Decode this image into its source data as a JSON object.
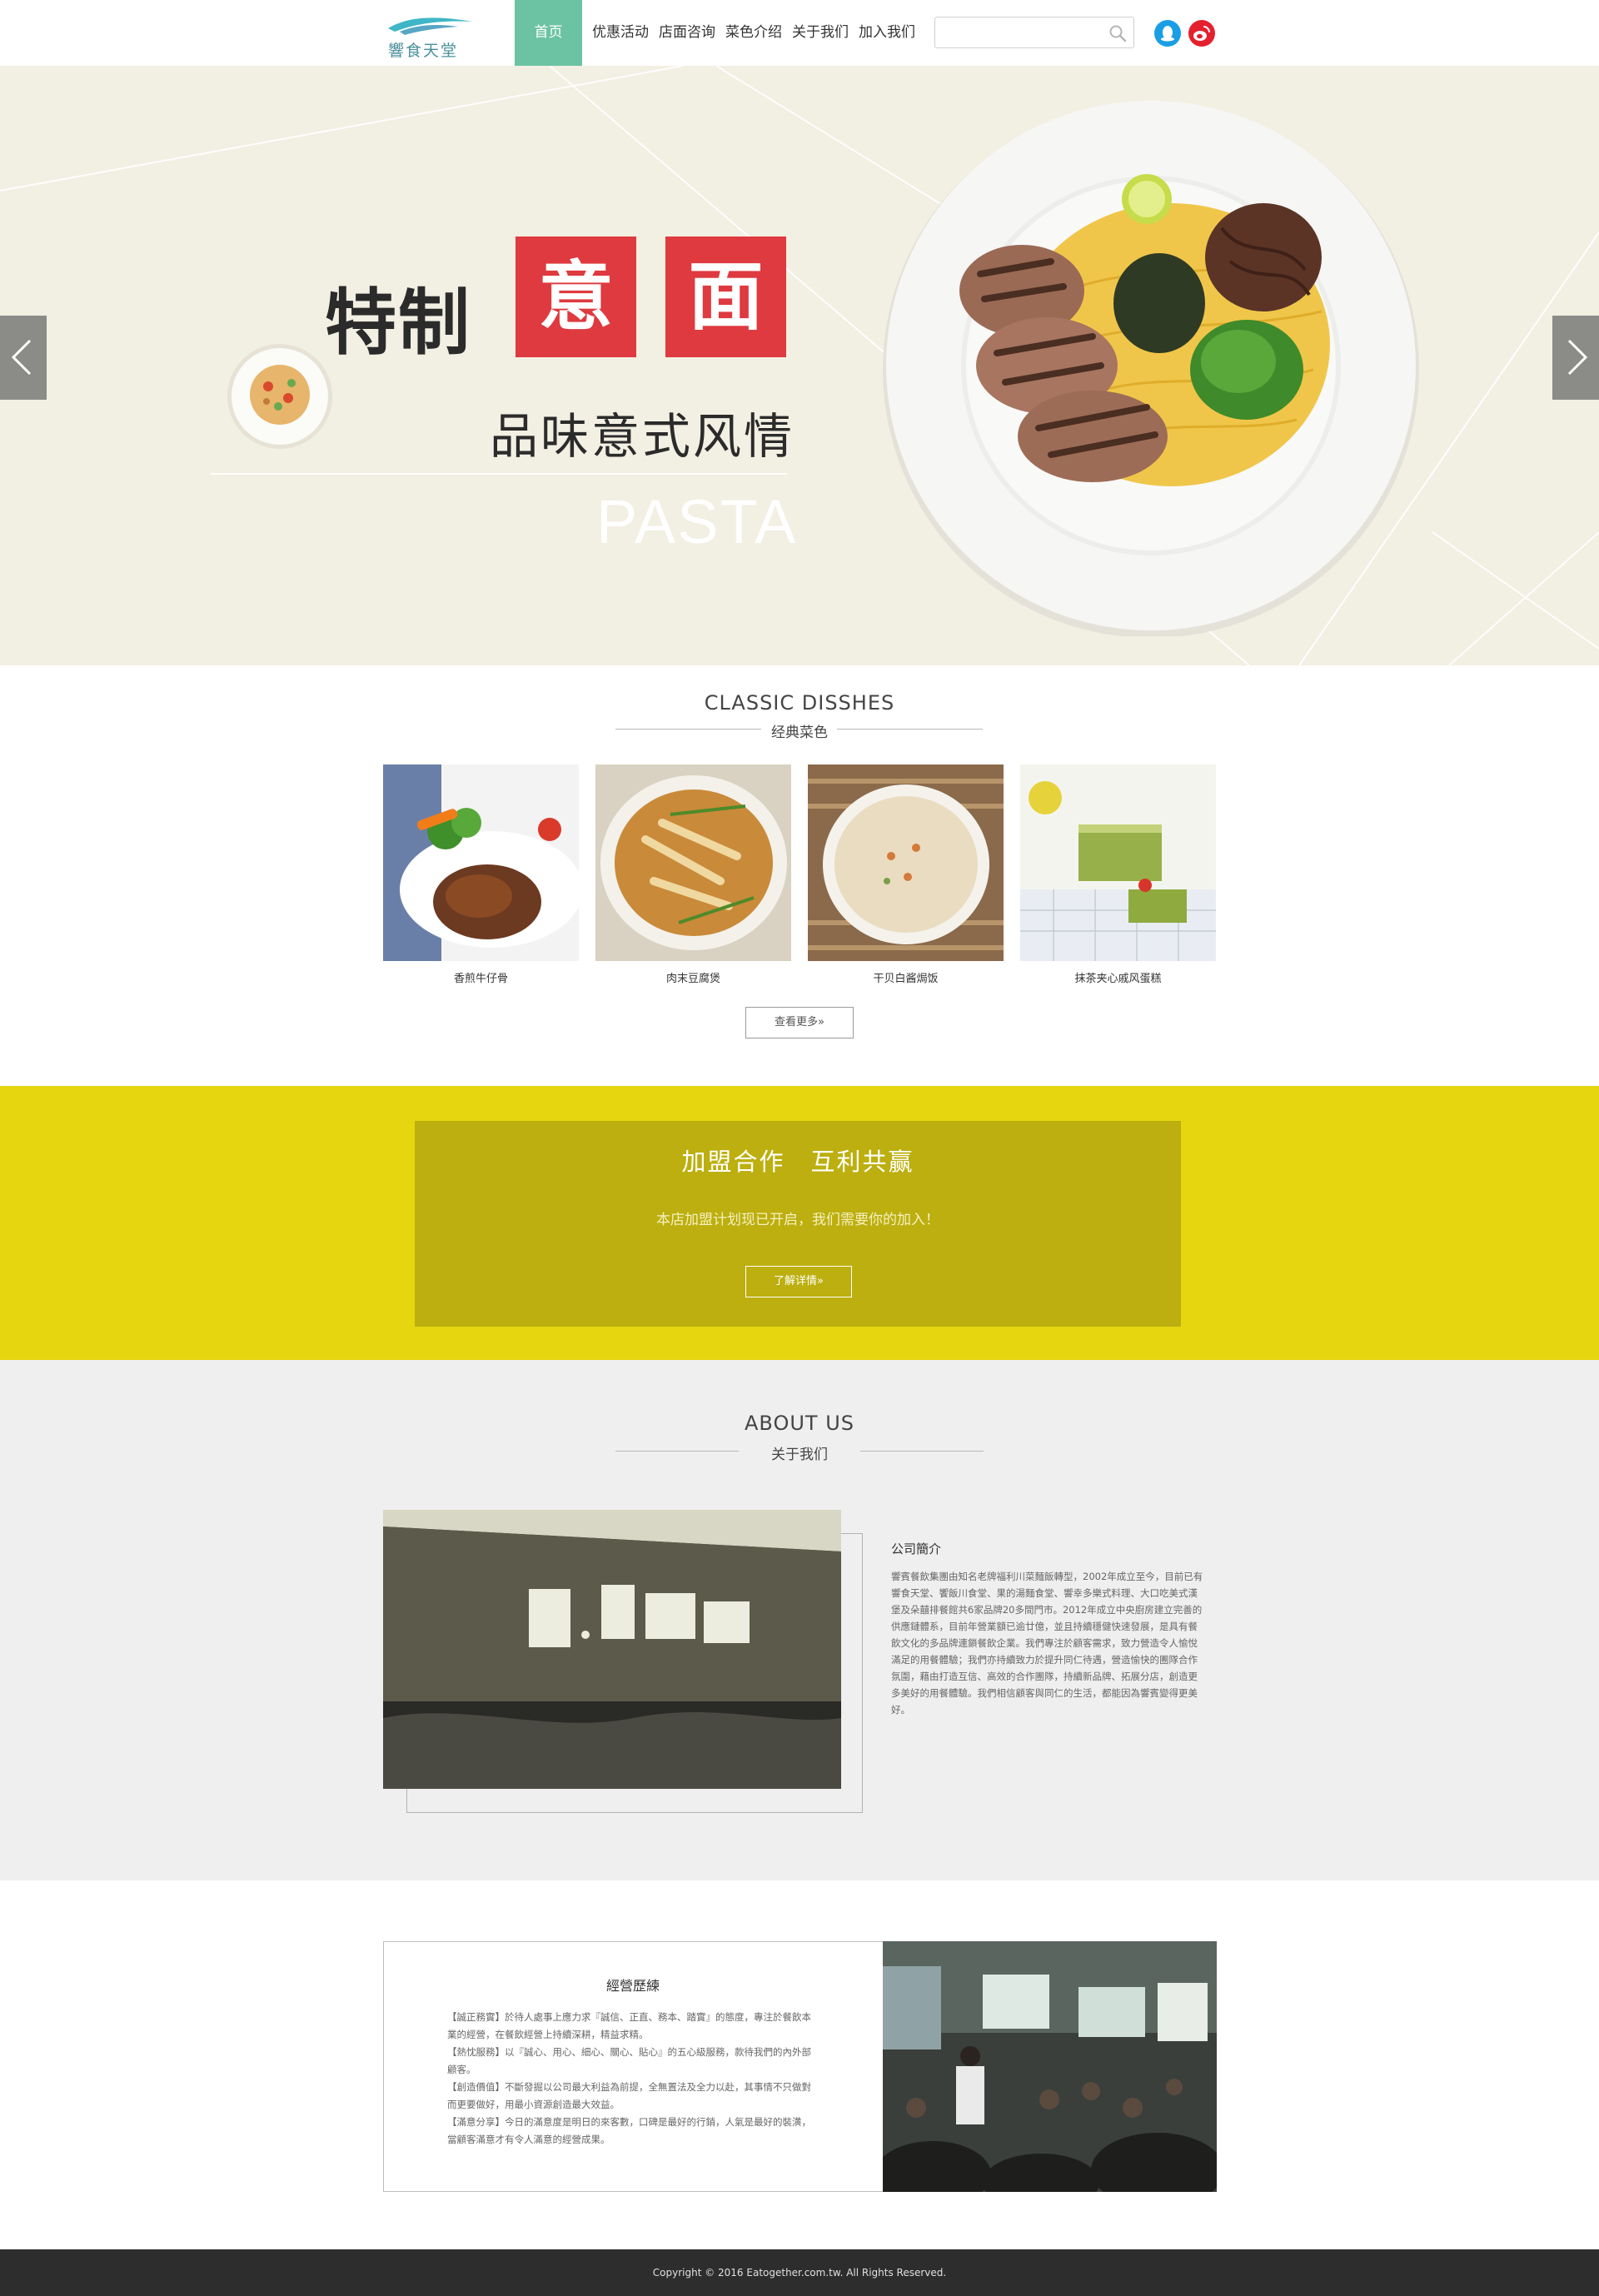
{
  "header": {
    "logo_text": "響食天堂",
    "nav": [
      "首页",
      "优惠活动",
      "店面咨询",
      "菜色介绍",
      "关于我们",
      "加入我们"
    ],
    "search_placeholder": ""
  },
  "banner": {
    "title_prefix": "特制",
    "title_char_1": "意",
    "title_char_2": "面",
    "subtitle": "品味意式风情",
    "english": "PASTA"
  },
  "dishes_section": {
    "title": "CLASSIC DISSHES",
    "subtitle": "经典菜色",
    "items": [
      "香煎牛仔骨",
      "肉末豆腐煲",
      "干贝白酱焗饭",
      "抹茶夹心戚风蛋糕"
    ],
    "more_button": "查看更多»"
  },
  "franchise": {
    "title": "加盟合作　互利共赢",
    "description": "本店加盟计划现已开启，我们需要你的加入！",
    "button": "了解详情»"
  },
  "about": {
    "title": "ABOUT US",
    "subtitle": "关于我们",
    "heading": "公司簡介",
    "body": "響賓餐飲集團由知名老牌福利川菜麵飯轉型，2002年成立至今，目前已有響食天堂、饗飯川食堂、果的湯麵食堂、響幸多樂式料理、大口吃美式漢堡及朵囍排餐館共6家品牌20多間門市。2012年成立中央廚房建立完善的供應鏈體系，目前年營業額已逾廿億，並且持續穩健快速發展，是具有餐飲文化的多品牌連鎖餐飲企業。我們專注於顧客需求，致力營造令人愉悅滿足的用餐體驗；我們亦持續致力於提升同仁待遇，營造愉快的團隊合作氛圍，藉由打造互信、高效的合作團隊，持續新品牌、拓展分店，創造更多美好的用餐體驗。我們相信顧客與同仁的生活，都能因為響賓變得更美好。"
  },
  "history": {
    "title": "經營歷練",
    "paragraphs": [
      "【誠正務實】於待人處事上應力求『誠信、正直、務本、踏實』的態度，專注於餐飲本業的經營，在餐飲經營上持續深耕，精益求精。",
      "【熱忱服務】以『誠心、用心、細心、關心、貼心』的五心級服務，款待我們的內外部顧客。",
      "【創造價值】不斷發掘以公司最大利益為前提，全無置法及全力以赴，其事情不只做對而更要做好，用最小資源創造最大效益。",
      "【滿意分享】今日的滿意度是明日的來客數，口碑是最好的行銷，人氣是最好的裝潢，當顧客滿意才有令人滿意的經營成果。"
    ]
  },
  "footer": {
    "copyright": "Copyright © 2016 Eatogether.com.tw. All Rights Reserved."
  },
  "colors": {
    "nav_active": "#6cc3a4",
    "banner_bg": "#f2efe3",
    "accent_red": "#de3a3f",
    "franchise_bg": "#e5d60f",
    "franchise_box": "#bcaf0f",
    "about_bg": "#efefef",
    "footer_bg": "#2d2d2d"
  }
}
